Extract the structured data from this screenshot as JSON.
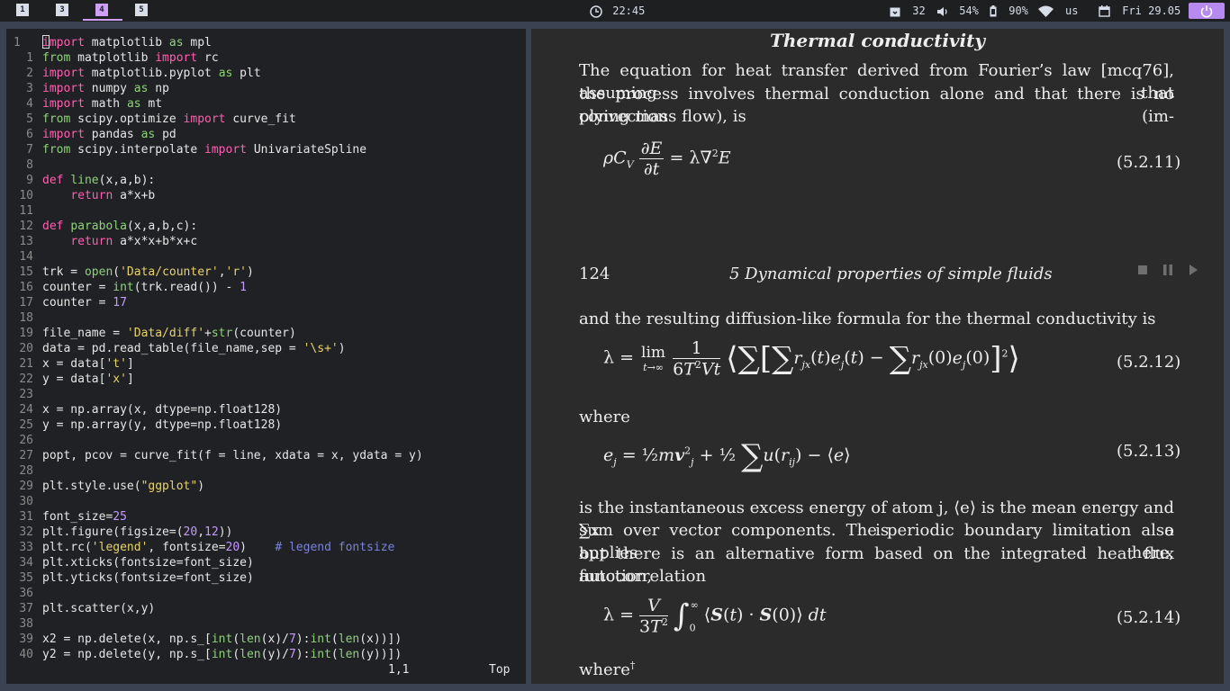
{
  "topbar": {
    "workspaces": [
      "1",
      "3",
      "4",
      "5"
    ],
    "active_workspace": "4",
    "clock": "22:45",
    "updates": "32",
    "volume": "54%",
    "battery": "90%",
    "keyboard_layout": "us",
    "date": "Fri 29.05",
    "accent_color": "#b78af0"
  },
  "editor": {
    "line_numbers": [
      "1",
      "1",
      "2",
      "3",
      "4",
      "5",
      "6",
      "7",
      "8",
      "9",
      "10",
      "11",
      "12",
      "13",
      "14",
      "15",
      "16",
      "17",
      "18",
      "19",
      "20",
      "21",
      "22",
      "23",
      "24",
      "25",
      "26",
      "27",
      "28",
      "29",
      "30",
      "31",
      "32",
      "33",
      "34",
      "35",
      "36",
      "37",
      "38",
      "39",
      "40"
    ],
    "lines": [
      "import matplotlib as mpl",
      "from matplotlib import rc",
      "import matplotlib.pyplot as plt",
      "import numpy as np",
      "import math as mt",
      "from scipy.optimize import curve_fit",
      "import pandas as pd",
      "from scipy.interpolate import UnivariateSpline",
      "",
      "def line(x,a,b):",
      "    return a*x+b",
      "",
      "def parabola(x,a,b,c):",
      "    return a*x*x+b*x+c",
      "",
      "trk = open('Data/counter','r')",
      "counter = int(trk.read()) - 1",
      "counter = 17",
      "",
      "file_name = 'Data/diff'+str(counter)",
      "data = pd.read_table(file_name,sep = '\\s+')",
      "x = data['t']",
      "y = data['x']",
      "",
      "x = np.array(x, dtype=np.float128)",
      "y = np.array(y, dtype=np.float128)",
      "",
      "popt, pcov = curve_fit(f = line, xdata = x, ydata = y)",
      "",
      "plt.style.use(\"ggplot\")",
      "",
      "font_size=25",
      "plt.figure(figsize=(20,12))",
      "plt.rc('legend', fontsize=20)    # legend fontsize",
      "plt.xticks(fontsize=font_size)",
      "plt.yticks(fontsize=font_size)",
      "",
      "plt.scatter(x,y)",
      "",
      "x2 = np.delete(x, np.s_[int(len(x)/7):int(len(x))])",
      "y2 = np.delete(y, np.s_[int(len(y)/7):int(len(y))])"
    ],
    "cursor_position": "1,1",
    "scroll_position": "Top"
  },
  "pdf": {
    "section_title": "Thermal conductivity",
    "para1": [
      "The equation for heat transfer derived from Fourier’s law [mcq76], assuming that",
      "the process involves thermal conduction alone and that there is no convection (im-",
      "plying mass flow), is"
    ],
    "eq_5_2_11_no": "(5.2.11)",
    "page_number": "124",
    "running_header": "5  Dynamical properties of simple fluids",
    "para2": "and the resulting diffusion-like formula for the thermal conductivity is",
    "eq_5_2_12_no": "(5.2.12)",
    "where1": "where",
    "eq_5_2_13_no": "(5.2.13)",
    "para3": [
      "is the instantaneous excess energy of atom j, ⟨e⟩ is the mean energy and ∑x is a",
      "sum over vector components. The periodic boundary limitation also applies here,",
      "but there is an alternative form based on the integrated heat flux autocorrelation",
      "function,"
    ],
    "eq_5_2_14_no": "(5.2.14)",
    "where2": "where",
    "where2_mark": "†"
  }
}
